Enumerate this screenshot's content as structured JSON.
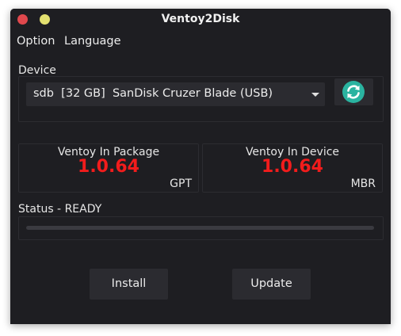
{
  "window": {
    "title": "Ventoy2Disk"
  },
  "menubar": {
    "items": [
      "Option",
      "Language"
    ]
  },
  "device": {
    "label": "Device",
    "selected": "sdb  [32 GB]  SanDisk Cruzer Blade (USB)",
    "refresh_icon": "refresh-icon"
  },
  "package": {
    "title": "Ventoy In Package",
    "version": "1.0.64",
    "partition_style": "GPT"
  },
  "installed": {
    "title": "Ventoy In Device",
    "version": "1.0.64",
    "partition_style": "MBR"
  },
  "status": {
    "text": "Status - READY",
    "progress": 0
  },
  "actions": {
    "install_label": "Install",
    "update_label": "Update"
  },
  "colors": {
    "window_bg": "#1e1e22",
    "version_red": "#f21c1c",
    "close_button": "#e0484d",
    "minimize_button": "#e3e070",
    "refresh_teal": "#2ab3a0"
  }
}
